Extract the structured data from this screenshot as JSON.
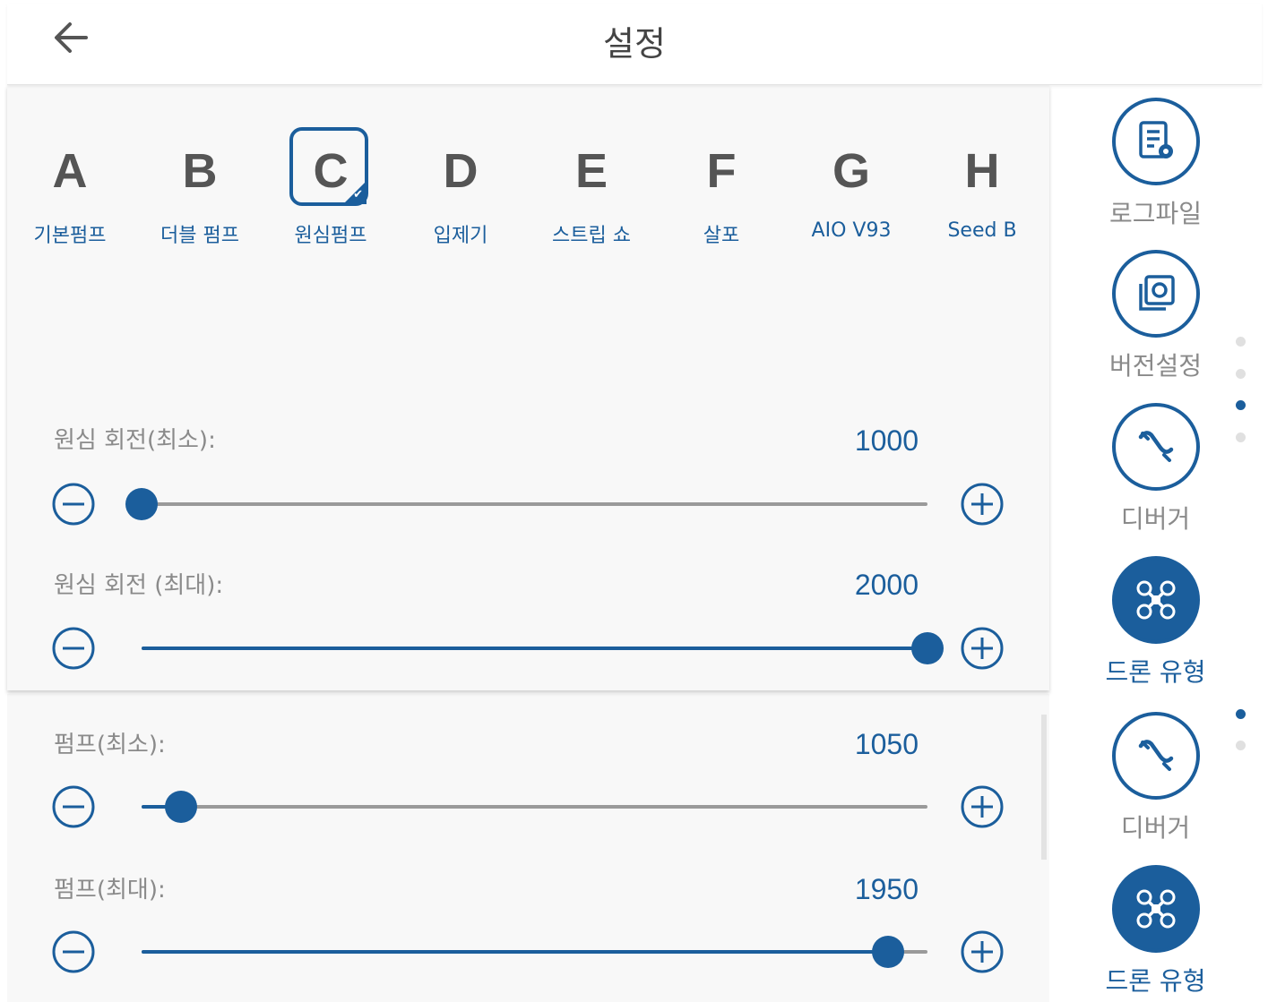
{
  "header": {
    "title": "설정",
    "back_icon": "arrow-left-icon"
  },
  "drone_types": {
    "selected": "C",
    "items": [
      {
        "letter": "A",
        "name": "기본펌프"
      },
      {
        "letter": "B",
        "name": "더블 펌프"
      },
      {
        "letter": "C",
        "name": "원심펌프"
      },
      {
        "letter": "D",
        "name": "입제기"
      },
      {
        "letter": "E",
        "name": "스트립 쇼"
      },
      {
        "letter": "F",
        "name": "살포"
      },
      {
        "letter": "G",
        "name": "AIO V93"
      },
      {
        "letter": "H",
        "name": "Seed B"
      }
    ]
  },
  "sliders": [
    {
      "label": "원심 회전(최소):",
      "value": "1000",
      "fraction": 0.0
    },
    {
      "label": "원심 회전 (최대):",
      "value": "2000",
      "fraction": 1.0
    },
    {
      "label": "펌프(최소):",
      "value": "1050",
      "fraction": 0.05
    },
    {
      "label": "펌프(최대):",
      "value": "1950",
      "fraction": 0.95
    }
  ],
  "side_menu_top": [
    {
      "label": "로그파일",
      "icon": "log-file-icon",
      "active": false
    },
    {
      "label": "버전설정",
      "icon": "version-icon",
      "active": false
    },
    {
      "label": "디버거",
      "icon": "debugger-icon",
      "active": false
    },
    {
      "label": "드론 유형",
      "icon": "drone-icon",
      "active": true
    }
  ],
  "side_menu_bottom": [
    {
      "label": "디버거",
      "icon": "debugger-icon",
      "active": false
    },
    {
      "label": "드론 유형",
      "icon": "drone-icon",
      "active": true
    }
  ],
  "colors": {
    "accent": "#1b5e9c",
    "label_gray": "#8a8a8a",
    "track_gray": "#9a9a9a"
  }
}
